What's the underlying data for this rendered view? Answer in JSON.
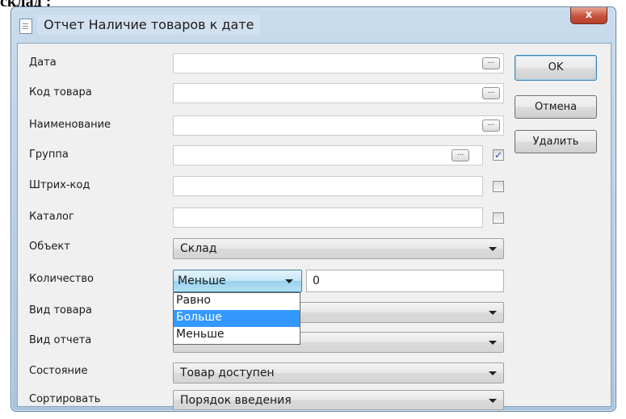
{
  "page_caption": "склад :",
  "window": {
    "title": "Отчет Наличие товаров к дате",
    "close_label": "x"
  },
  "fields": {
    "date": {
      "label": "Дата",
      "value": "",
      "button": "..."
    },
    "code": {
      "label": "Код товара",
      "value": "",
      "button": "..."
    },
    "name": {
      "label": "Наименование",
      "value": "",
      "button": "..."
    },
    "group": {
      "label": "Группа",
      "value": "",
      "button": "...",
      "checked": true
    },
    "barcode": {
      "label": "Штрих-код",
      "value": "",
      "checked": false
    },
    "catalog": {
      "label": "Каталог",
      "value": "",
      "checked": false
    },
    "object": {
      "label": "Объект",
      "value": "Склад"
    },
    "quantity": {
      "label": "Количество",
      "operator": "Меньше",
      "value": "0",
      "options": [
        "Равно",
        "Больше",
        "Меньше"
      ],
      "highlighted": "Больше"
    },
    "item_type": {
      "label": "Вид товара",
      "value": ""
    },
    "report_type": {
      "label": "Вид отчета",
      "value": ""
    },
    "state": {
      "label": "Состояние",
      "value": "Товар доступен"
    },
    "sort": {
      "label": "Сортировать",
      "value": "Порядок введения"
    }
  },
  "buttons": {
    "ok": "OK",
    "cancel": "Отмена",
    "delete": "Удалить"
  },
  "check_mark": "✓",
  "colors": {
    "title_bar": "#b9d1ea",
    "close_button": "#c5523a",
    "selection": "#3399ff",
    "client_bg": "#f0f0f0"
  }
}
